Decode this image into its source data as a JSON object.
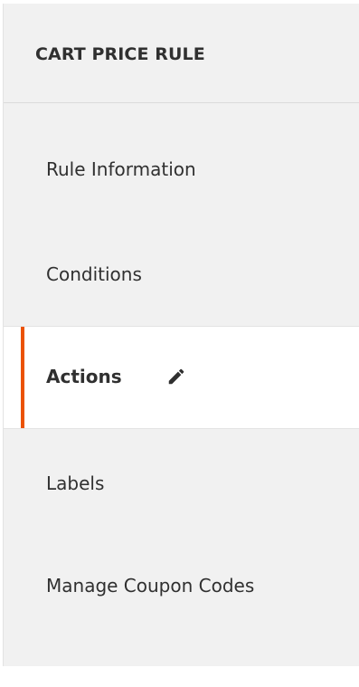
{
  "sidebar": {
    "title": "CART PRICE RULE",
    "items": [
      {
        "label": "Rule Information",
        "active": false
      },
      {
        "label": "Conditions",
        "active": false
      },
      {
        "label": "Actions",
        "active": true,
        "icon": "pencil-icon"
      },
      {
        "label": "Labels",
        "active": false
      },
      {
        "label": "Manage Coupon Codes",
        "active": false
      }
    ]
  },
  "colors": {
    "active_accent": "#eb5202",
    "panel_background": "#f1f1f1",
    "active_background": "#ffffff",
    "text": "#303030"
  }
}
